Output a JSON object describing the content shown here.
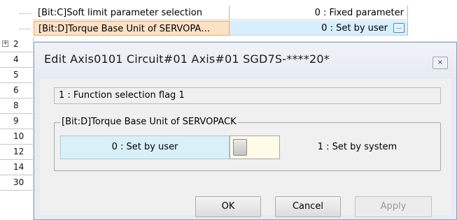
{
  "grid": {
    "rows": [
      {
        "name": "[Bit:C]Soft limit parameter selection",
        "value": "0 : Fixed parameter"
      },
      {
        "name": "[Bit:D]Torque Base Unit of SERVOPA…",
        "value": "0 : Set by user",
        "button": "..."
      }
    ],
    "row_numbers": [
      "2",
      "4",
      "5",
      "6",
      "8",
      "9",
      "10",
      "12",
      "14",
      "30"
    ],
    "expander": "+"
  },
  "dialog": {
    "title": "Edit  Axis0101  Circuit#01 Axis#01  SGD7S-****20*",
    "close_icon": "close-icon",
    "function_flag": "1 : Function selection flag 1",
    "group_label": "[Bit:D]Torque Base Unit of SERVOPACK",
    "option_off": "0 : Set by user",
    "option_on": "1 : Set by system",
    "selected": "0",
    "buttons": {
      "ok": "OK",
      "cancel": "Cancel",
      "apply": "Apply"
    }
  },
  "colors": {
    "selected_row": "#fbe2c7",
    "selected_value": "#d7eefc",
    "option_highlight": "#d9f0f8",
    "toggle_bg": "#fffbe6"
  }
}
